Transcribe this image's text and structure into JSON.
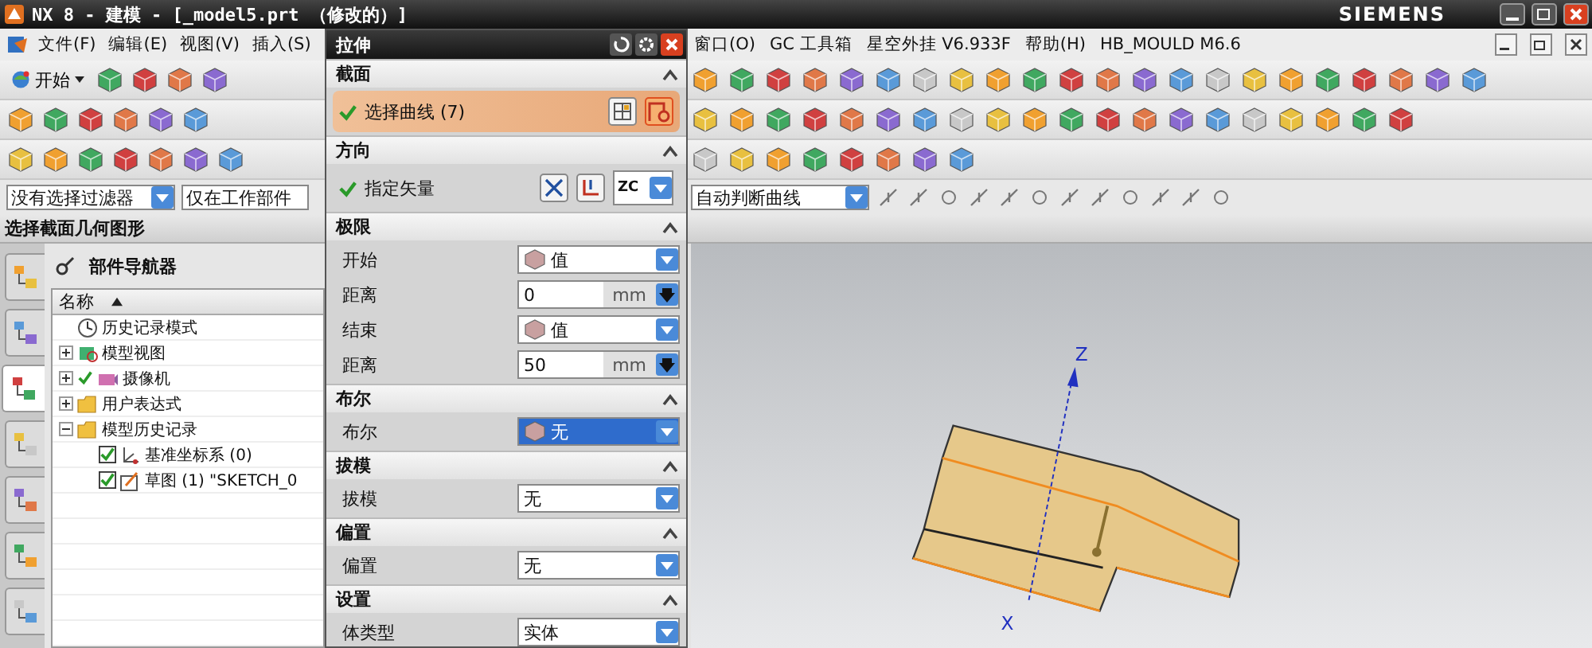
{
  "window": {
    "title": "NX 8 - 建模 - [_model5.prt （修改的）]",
    "brand": "SIEMENS"
  },
  "menu": {
    "left": [
      "文件(F)",
      "编辑(E)",
      "视图(V)",
      "插入(S)"
    ],
    "right": [
      "窗口(O)",
      "GC 工具箱",
      "星空外挂 V6.933F",
      "帮助(H)",
      "HB_MOULD M6.6"
    ]
  },
  "toolbar": {
    "start_label": "开始"
  },
  "filter_bar": {
    "type_filter": "没有选择过滤器",
    "scope_filter": "仅在工作部件",
    "curve_rule": "自动判断曲线"
  },
  "status_prompt": "选择截面几何图形",
  "resource_tabs": [
    {
      "selected": false
    },
    {
      "selected": false
    },
    {
      "selected": true
    },
    {
      "selected": false
    },
    {
      "selected": false
    },
    {
      "selected": false
    },
    {
      "selected": false
    }
  ],
  "navigator": {
    "title": "部件导航器",
    "column": "名称",
    "items": [
      {
        "label": "历史记录模式",
        "kind": "history"
      },
      {
        "label": "模型视图",
        "kind": "views",
        "expanded": false
      },
      {
        "label": "摄像机",
        "kind": "camera",
        "expanded": false,
        "checked": true
      },
      {
        "label": "用户表达式",
        "kind": "folder",
        "expanded": false
      },
      {
        "label": "模型历史记录",
        "kind": "folder",
        "expanded": true,
        "children": [
          {
            "label": "基准坐标系 (0)",
            "kind": "datum",
            "checked": true
          },
          {
            "label": "草图 (1) \"SKETCH_0",
            "kind": "sketch",
            "checked": true
          }
        ]
      }
    ]
  },
  "dialog": {
    "title": "拉伸",
    "sections": [
      {
        "title": "截面",
        "expanded": true,
        "rows": [
          {
            "kind": "selection",
            "label": "选择曲线 (7)",
            "complete": true,
            "active": true
          }
        ]
      },
      {
        "title": "方向",
        "expanded": true,
        "rows": [
          {
            "kind": "vector",
            "label": "指定矢量",
            "complete": true,
            "active": false,
            "vector": "ZC"
          }
        ]
      },
      {
        "title": "极限",
        "expanded": true,
        "rows": [
          {
            "kind": "dropdown",
            "label": "开始",
            "value": "值",
            "has_icon": true,
            "selected": false
          },
          {
            "kind": "number",
            "label": "距离",
            "value": "0",
            "unit": "mm"
          },
          {
            "kind": "dropdown",
            "label": "结束",
            "value": "值",
            "has_icon": true,
            "selected": false
          },
          {
            "kind": "number",
            "label": "距离",
            "value": "50",
            "unit": "mm"
          }
        ]
      },
      {
        "title": "布尔",
        "expanded": true,
        "rows": [
          {
            "kind": "dropdown",
            "label": "布尔",
            "value": "无",
            "has_icon": true,
            "selected": true
          }
        ]
      },
      {
        "title": "拔模",
        "expanded": true,
        "rows": [
          {
            "kind": "dropdown",
            "label": "拔模",
            "value": "无",
            "has_icon": false,
            "selected": false
          }
        ]
      },
      {
        "title": "偏置",
        "expanded": true,
        "rows": [
          {
            "kind": "dropdown",
            "label": "偏置",
            "value": "无",
            "has_icon": false,
            "selected": false
          }
        ]
      },
      {
        "title": "设置",
        "expanded": true,
        "rows": [
          {
            "kind": "dropdown",
            "label": "体类型",
            "value": "实体",
            "has_icon": false,
            "selected": false
          }
        ]
      }
    ]
  },
  "viewport": {
    "axis_labels": [
      "Z",
      "X"
    ]
  }
}
